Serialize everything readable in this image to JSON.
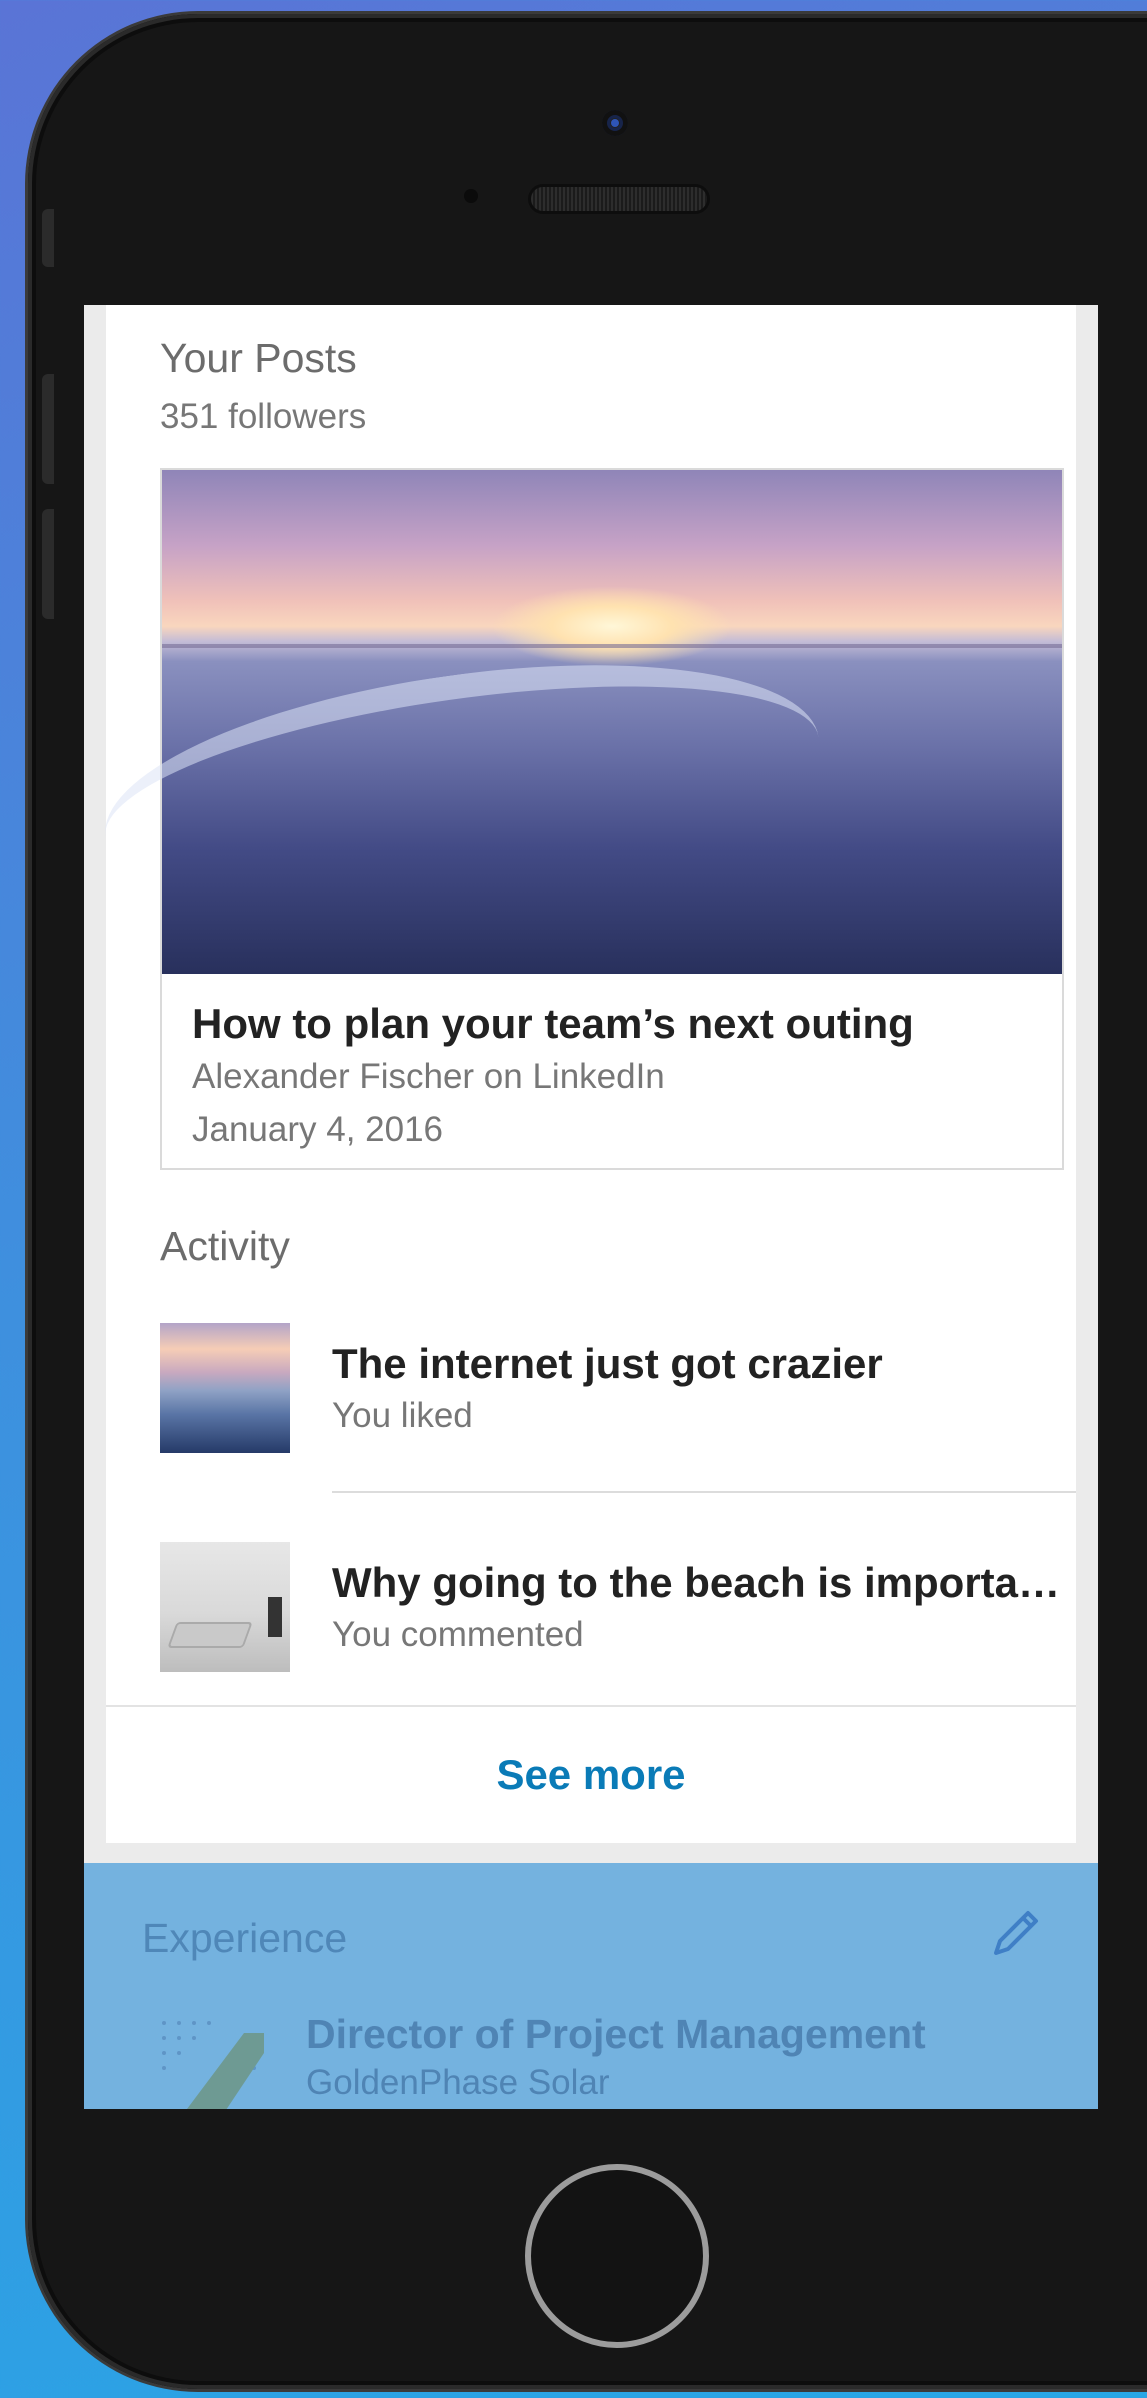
{
  "posts": {
    "section_title": "Your Posts",
    "followers": "351 followers",
    "article": {
      "title": "How to plan your team’s next outing",
      "author": "Alexander Fischer on LinkedIn",
      "date": "January 4, 2016"
    }
  },
  "activity": {
    "section_title": "Activity",
    "items": [
      {
        "title": "The internet just got crazier",
        "action": "You liked"
      },
      {
        "title": "Why going to the beach is importa…",
        "action": "You commented"
      }
    ],
    "see_more": "See more"
  },
  "experience": {
    "section_title": "Experience",
    "job_title": "Director of Project Management",
    "company": "GoldenPhase Solar"
  },
  "colors": {
    "link": "#0a7bb7",
    "experience_bg": "#74b2df"
  },
  "icons": [
    "pencil-edit-icon",
    "company-logo-icon"
  ]
}
